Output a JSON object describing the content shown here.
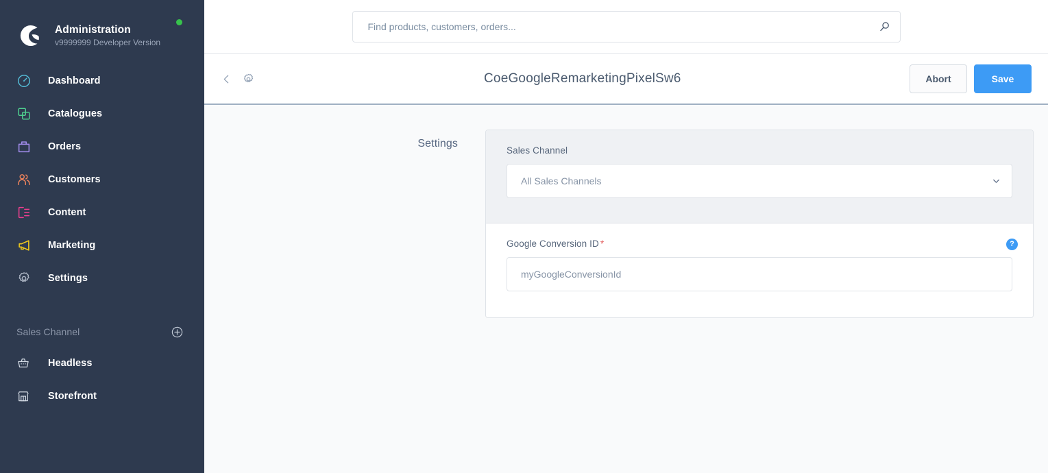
{
  "sidebar": {
    "brand": {
      "logo_icon": "shopware-logo-icon",
      "title": "Administration",
      "version": "v9999999 Developer Version",
      "status_dot_color": "#37c24c"
    },
    "nav_items": [
      {
        "label": "Dashboard",
        "icon": "dashboard-icon",
        "color": "#54bcd6"
      },
      {
        "label": "Catalogues",
        "icon": "catalogues-icon",
        "color": "#4ecf8f"
      },
      {
        "label": "Orders",
        "icon": "orders-icon",
        "color": "#a58ef0"
      },
      {
        "label": "Customers",
        "icon": "customers-icon",
        "color": "#f0845c"
      },
      {
        "label": "Content",
        "icon": "content-icon",
        "color": "#ef3f8f"
      },
      {
        "label": "Marketing",
        "icon": "marketing-icon",
        "color": "#f2ca1c"
      },
      {
        "label": "Settings",
        "icon": "gear-icon",
        "color": "#aab3c2"
      }
    ],
    "sales_channel_section": {
      "title": "Sales Channel",
      "add_icon": "plus-circle-icon",
      "items": [
        {
          "label": "Headless",
          "icon": "basket-icon"
        },
        {
          "label": "Storefront",
          "icon": "storefront-icon"
        }
      ]
    }
  },
  "search": {
    "placeholder": "Find products, customers, orders...",
    "value": "",
    "icon": "search-icon"
  },
  "header": {
    "back_icon": "chevron-left-icon",
    "gear_icon": "gear-icon",
    "title": "CoeGoogleRemarketingPixelSw6",
    "abort_label": "Abort",
    "save_label": "Save",
    "save_color": "#3d9bf5"
  },
  "form": {
    "section_label": "Settings",
    "sales_channel": {
      "label": "Sales Channel",
      "selected": "All Sales Channels",
      "chevron_icon": "chevron-down-icon"
    },
    "google_conversion_id": {
      "label": "Google Conversion ID",
      "required_marker": "*",
      "placeholder": "myGoogleConversionId",
      "value": "",
      "help_icon": "help-icon",
      "help_glyph": "?"
    }
  }
}
